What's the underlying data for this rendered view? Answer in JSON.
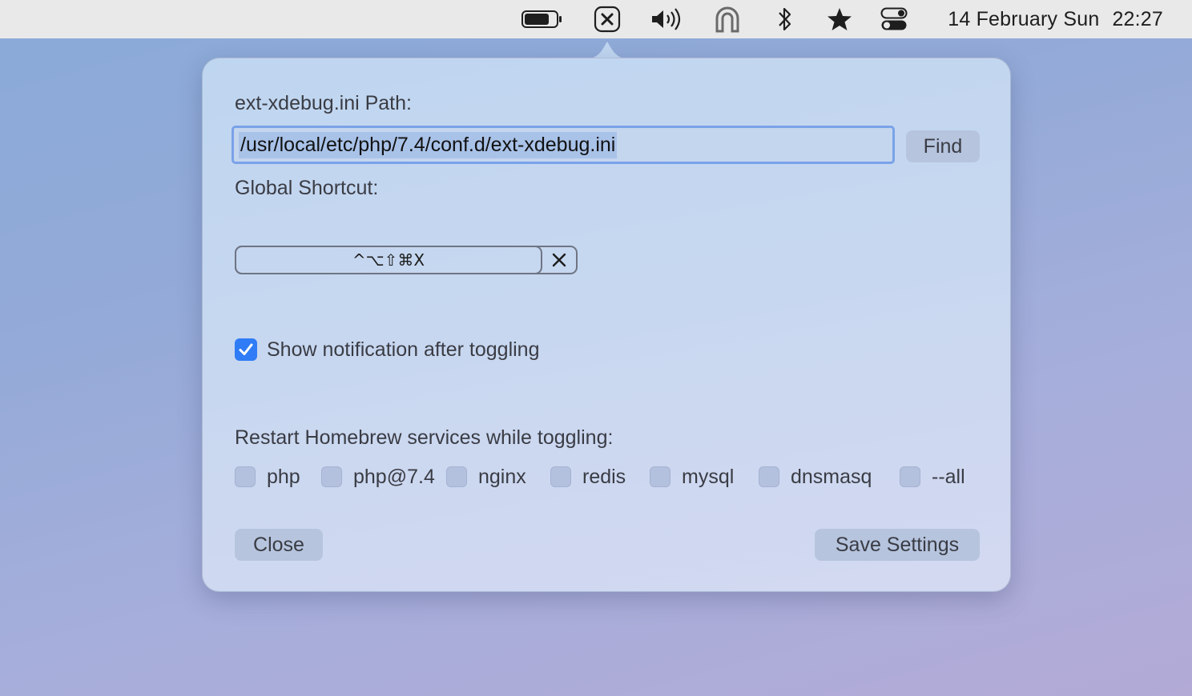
{
  "menubar": {
    "icons": [
      "battery-icon",
      "xdebug-toggle-icon",
      "volume-icon",
      "magnet-icon",
      "bluetooth-icon",
      "star-icon",
      "control-center-icon"
    ],
    "date": "14 February Sun",
    "time": "22:27"
  },
  "popover": {
    "path_label": "ext-xdebug.ini Path:",
    "path_value": "/usr/local/etc/php/7.4/conf.d/ext-xdebug.ini",
    "find_label": "Find",
    "shortcut_label": "Global Shortcut:",
    "shortcut_keys": "^⌥⇧⌘X",
    "notification_label": "Show notification after toggling",
    "notification_checked": true,
    "services_label": "Restart Homebrew services while toggling:",
    "services": [
      {
        "label": "php",
        "checked": false
      },
      {
        "label": "php@7.4",
        "checked": false
      },
      {
        "label": "nginx",
        "checked": false
      },
      {
        "label": "redis",
        "checked": false
      },
      {
        "label": "mysql",
        "checked": false
      },
      {
        "label": "dnsmasq",
        "checked": false
      },
      {
        "label": "--all",
        "checked": false
      }
    ],
    "close_label": "Close",
    "save_label": "Save Settings"
  },
  "colors": {
    "accent": "#2f7cf6",
    "focus_ring": "#7aa2e8",
    "button_bg": "#b6c4de"
  }
}
